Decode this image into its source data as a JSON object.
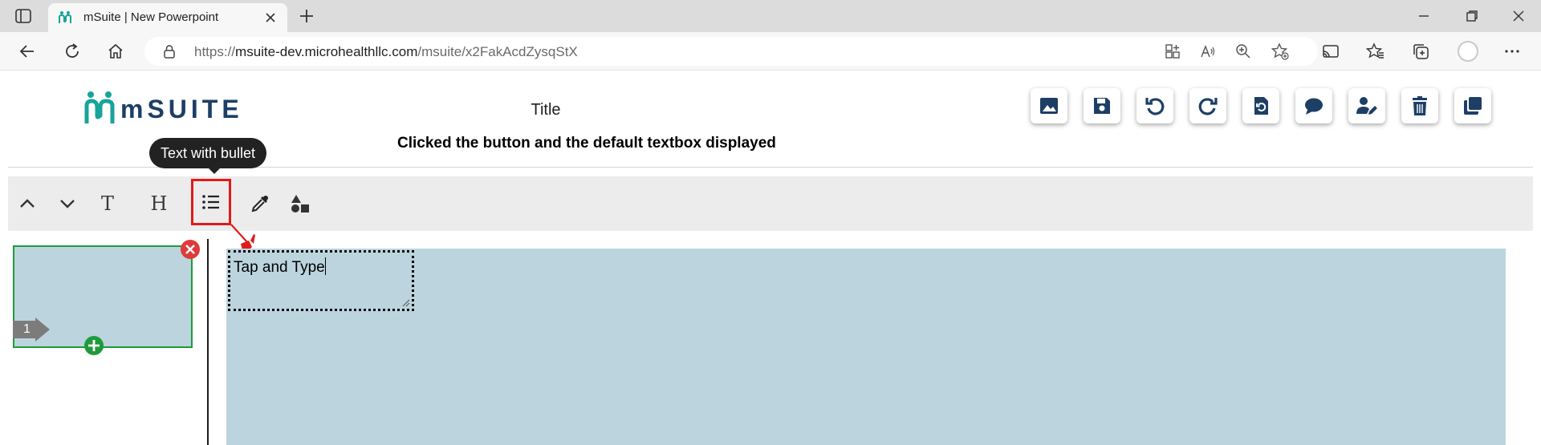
{
  "browser": {
    "tab_title": "mSuite | New Powerpoint",
    "url_host": "msuite-dev.microhealthllc.com",
    "url_path": "/msuite/x2FakAcdZysqStX",
    "url_scheme": "https://"
  },
  "app": {
    "logo_text": "mSUITE",
    "doc_title": "Title",
    "caption": "Clicked the button and the default textbox displayed",
    "tooltip": "Text with bullet",
    "toolbar": {
      "text_tool_letter": "T",
      "heading_tool_letter": "H"
    },
    "slides": [
      {
        "number": "1"
      }
    ],
    "textbox_text": "Tap and Type",
    "colors": {
      "brand": "#1d3f66",
      "accent_teal": "#18a39b",
      "slide_bg": "#bcd4de",
      "thumb_border": "#1f9a3b",
      "highlight": "#e01b1b"
    }
  }
}
